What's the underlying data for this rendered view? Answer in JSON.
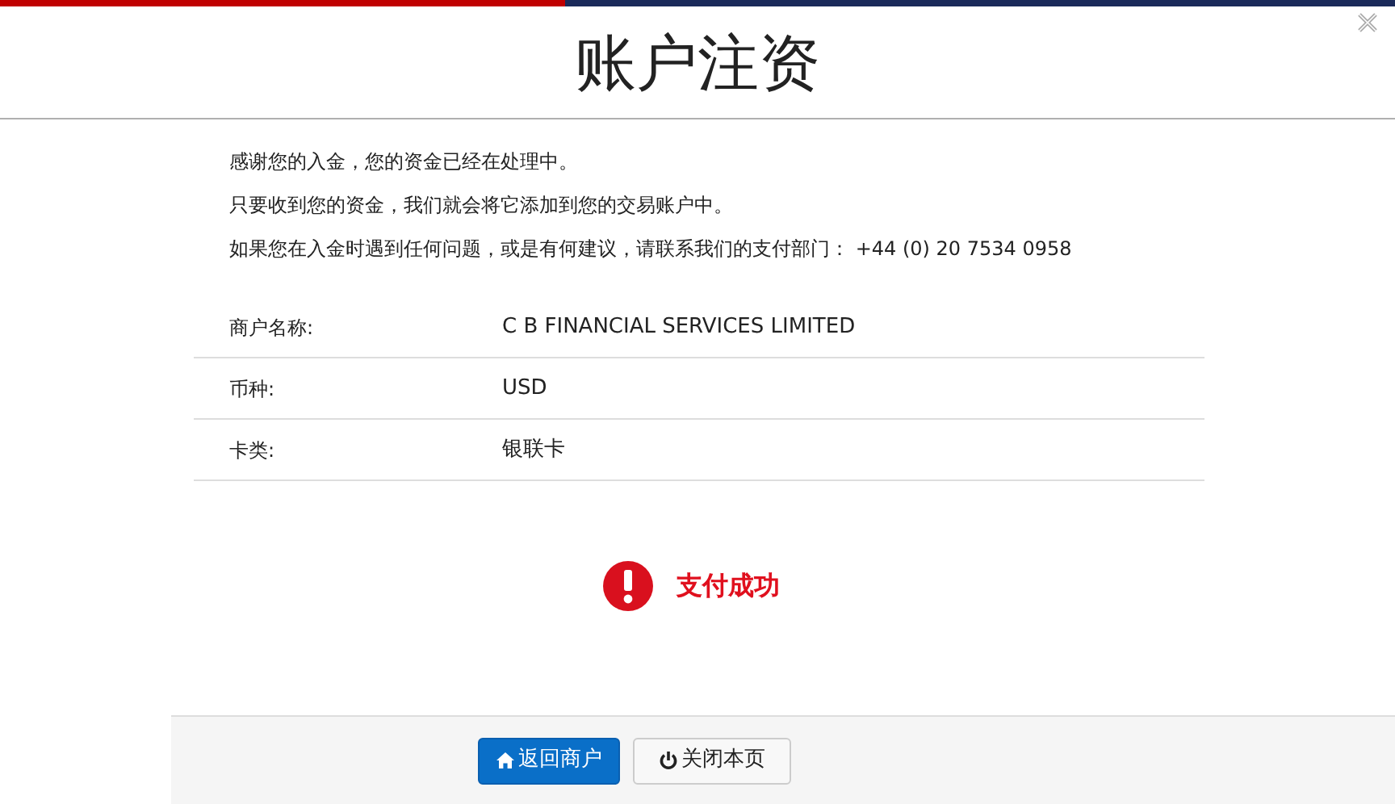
{
  "dialog": {
    "title": "账户注资"
  },
  "messages": [
    "感谢您的入金，您的资金已经在处理中。",
    "只要收到您的资金，我们就会将它添加到您的交易账户中。",
    "如果您在入金时遇到任何问题，或是有何建议，请联系我们的支付部门： +44 (0) 20 7534 0958"
  ],
  "details": [
    {
      "label": "商户名称:",
      "value": "C B FINANCIAL SERVICES LIMITED"
    },
    {
      "label": "币种:",
      "value": "USD"
    },
    {
      "label": "卡类:",
      "value": "银联卡"
    }
  ],
  "status": {
    "text": "支付成功"
  },
  "buttons": [
    {
      "label": "返回商户",
      "kind": "primary"
    },
    {
      "label": "关闭本页",
      "kind": "default"
    }
  ]
}
